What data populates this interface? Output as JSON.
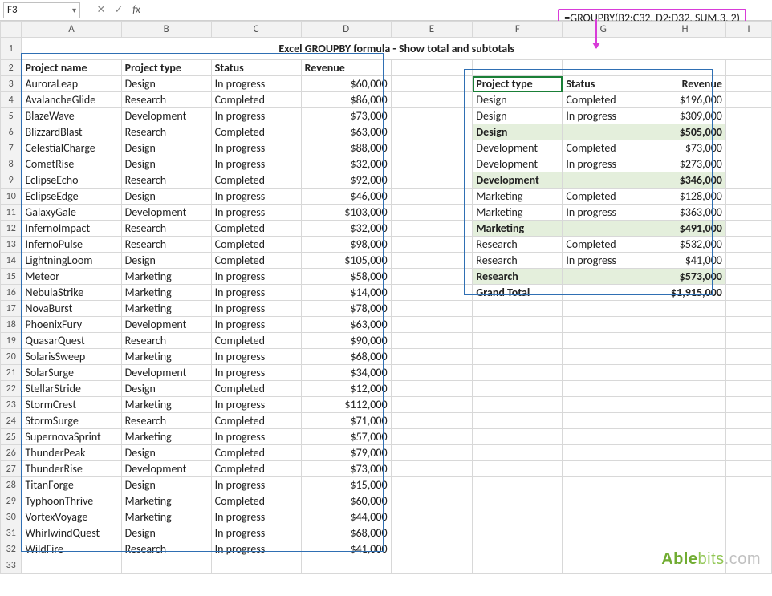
{
  "name_box": "F3",
  "formula": "=GROUPBY(B2:C32, D2:D32, SUM,3, 2)",
  "title": "Excel GROUPBY formula - Show total and subtotals",
  "col_headers": [
    "A",
    "B",
    "C",
    "D",
    "E",
    "F",
    "G",
    "H",
    "I"
  ],
  "src_headers": {
    "A": "Project name",
    "B": "Project type",
    "C": "Status",
    "D": "Revenue"
  },
  "out_headers": {
    "F": "Project type",
    "G": "Status",
    "H": "Revenue"
  },
  "source": [
    {
      "n": "AuroraLeap",
      "t": "Design",
      "s": "In progress",
      "r": "$60,000"
    },
    {
      "n": "AvalancheGlide",
      "t": "Research",
      "s": "Completed",
      "r": "$86,000"
    },
    {
      "n": "BlazeWave",
      "t": "Development",
      "s": "In progress",
      "r": "$73,000"
    },
    {
      "n": "BlizzardBlast",
      "t": "Research",
      "s": "Completed",
      "r": "$63,000"
    },
    {
      "n": "CelestialCharge",
      "t": "Design",
      "s": "In progress",
      "r": "$88,000"
    },
    {
      "n": "CometRise",
      "t": "Design",
      "s": "In progress",
      "r": "$32,000"
    },
    {
      "n": "EclipseEcho",
      "t": "Research",
      "s": "Completed",
      "r": "$92,000"
    },
    {
      "n": "EclipseEdge",
      "t": "Design",
      "s": "In progress",
      "r": "$46,000"
    },
    {
      "n": "GalaxyGale",
      "t": "Development",
      "s": "In progress",
      "r": "$103,000"
    },
    {
      "n": "InfernoImpact",
      "t": "Research",
      "s": "Completed",
      "r": "$32,000"
    },
    {
      "n": "InfernoPulse",
      "t": "Research",
      "s": "Completed",
      "r": "$98,000"
    },
    {
      "n": "LightningLoom",
      "t": "Design",
      "s": "Completed",
      "r": "$105,000"
    },
    {
      "n": "Meteor",
      "t": "Marketing",
      "s": "In progress",
      "r": "$58,000"
    },
    {
      "n": "NebulaStrike",
      "t": "Marketing",
      "s": "In progress",
      "r": "$14,000"
    },
    {
      "n": "NovaBurst",
      "t": "Marketing",
      "s": "In progress",
      "r": "$78,000"
    },
    {
      "n": "PhoenixFury",
      "t": "Development",
      "s": "In progress",
      "r": "$63,000"
    },
    {
      "n": "QuasarQuest",
      "t": "Research",
      "s": "Completed",
      "r": "$90,000"
    },
    {
      "n": "SolarisSweep",
      "t": "Marketing",
      "s": "In progress",
      "r": "$68,000"
    },
    {
      "n": "SolarSurge",
      "t": "Development",
      "s": "In progress",
      "r": "$34,000"
    },
    {
      "n": "StellarStride",
      "t": "Design",
      "s": "Completed",
      "r": "$12,000"
    },
    {
      "n": "StormCrest",
      "t": "Marketing",
      "s": "In progress",
      "r": "$112,000"
    },
    {
      "n": "StormSurge",
      "t": "Research",
      "s": "Completed",
      "r": "$71,000"
    },
    {
      "n": "SupernovaSprint",
      "t": "Marketing",
      "s": "In progress",
      "r": "$57,000"
    },
    {
      "n": "ThunderPeak",
      "t": "Design",
      "s": "Completed",
      "r": "$79,000"
    },
    {
      "n": "ThunderRise",
      "t": "Development",
      "s": "Completed",
      "r": "$73,000"
    },
    {
      "n": "TitanForge",
      "t": "Design",
      "s": "In progress",
      "r": "$15,000"
    },
    {
      "n": "TyphoonThrive",
      "t": "Marketing",
      "s": "Completed",
      "r": "$60,000"
    },
    {
      "n": "VortexVoyage",
      "t": "Marketing",
      "s": "In progress",
      "r": "$44,000"
    },
    {
      "n": "WhirlwindQuest",
      "t": "Design",
      "s": "In progress",
      "r": "$68,000"
    },
    {
      "n": "WildFire",
      "t": "Research",
      "s": "In progress",
      "r": "$41,000"
    }
  ],
  "output": [
    {
      "f": "Project type",
      "g": "Status",
      "h": "Revenue",
      "cls": "hdr"
    },
    {
      "f": "Design",
      "g": "Completed",
      "h": "$196,000"
    },
    {
      "f": "Design",
      "g": "In progress",
      "h": "$309,000"
    },
    {
      "f": "Design",
      "g": "",
      "h": "$505,000",
      "cls": "subtotal"
    },
    {
      "f": "Development",
      "g": "Completed",
      "h": "$73,000"
    },
    {
      "f": "Development",
      "g": "In progress",
      "h": "$273,000"
    },
    {
      "f": "Development",
      "g": "",
      "h": "$346,000",
      "cls": "subtotal"
    },
    {
      "f": "Marketing",
      "g": "Completed",
      "h": "$128,000"
    },
    {
      "f": "Marketing",
      "g": "In progress",
      "h": "$363,000"
    },
    {
      "f": "Marketing",
      "g": "",
      "h": "$491,000",
      "cls": "subtotal"
    },
    {
      "f": "Research",
      "g": "Completed",
      "h": "$532,000"
    },
    {
      "f": "Research",
      "g": "In progress",
      "h": "$41,000"
    },
    {
      "f": "Research",
      "g": "",
      "h": "$573,000",
      "cls": "subtotal"
    },
    {
      "f": "Grand Total",
      "g": "",
      "h": "$1,915,000",
      "cls": "gtotal"
    }
  ],
  "watermark": {
    "a": "Able",
    "b": "bits",
    "c": ".com"
  }
}
